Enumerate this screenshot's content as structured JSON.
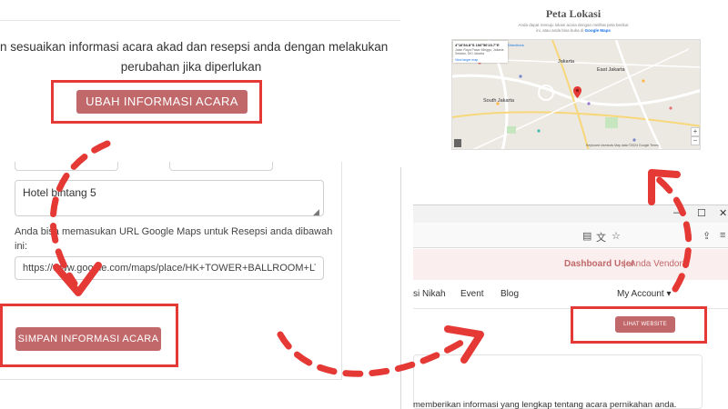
{
  "info_section": {
    "desc_line1": "n sesuaikan informasi acara akad dan resepsi anda dengan melakukan",
    "desc_line2": "perubahan jika diperlukan",
    "edit_button": "UBAH INFORMASI ACARA"
  },
  "form": {
    "venue_value": "Hotel bintang 5",
    "maps_info_line1": "Anda bisa memasukan URL Google Maps untuk Resepsi anda dibawah",
    "maps_info_line2": "ini:",
    "maps_url_value": "https://www.google.com/maps/place/HK+TOWER+BALLROOM+LT.",
    "save_button": "SIMPAN INFORMASI ACARA"
  },
  "map": {
    "title": "Peta Lokasi",
    "subtitle_line1": "Anda dapat menuju lokasi acara dengan melihat peta berikut",
    "subtitle_line2": "ini, atau anda bisa buka di",
    "subtitle_link": "Google Maps",
    "card_title": "4°16'54.8\"S 106°50'23.7\"E",
    "card_address": "Jalan Raya Pasar Minggu, Jakarta Selatan, DKI Jakarta",
    "larger_map": "View larger map",
    "directions": "Directions",
    "labels": [
      "Jakarta",
      "East Jakarta",
      "South Jakarta"
    ],
    "footer": "Keyboard shortcuts  Map data ©2024 Google  Terms",
    "zoom_in": "+",
    "zoom_out": "−"
  },
  "browser": {
    "window_controls": [
      "—",
      "☐",
      "✕"
    ],
    "toolbar_icons": [
      "reader-icon",
      "translate-icon",
      "star-icon",
      "extensions-icon",
      "share-icon",
      "menu-icon"
    ],
    "dashboard_user": "Dashboard User",
    "separator": "|",
    "vendor_link": "Anda Vendor?",
    "nav": [
      "si Nikah",
      "Event",
      "Blog",
      "My Account ▾"
    ],
    "view_site_button": "LIHAT WEBSITE",
    "info_text": "memberikan informasi yang lengkap tentang acara pernikahan anda."
  },
  "colors": {
    "button_rose": "#c1686a",
    "highlight_red": "#e53935",
    "dashboard_bg": "#fbeeee"
  }
}
